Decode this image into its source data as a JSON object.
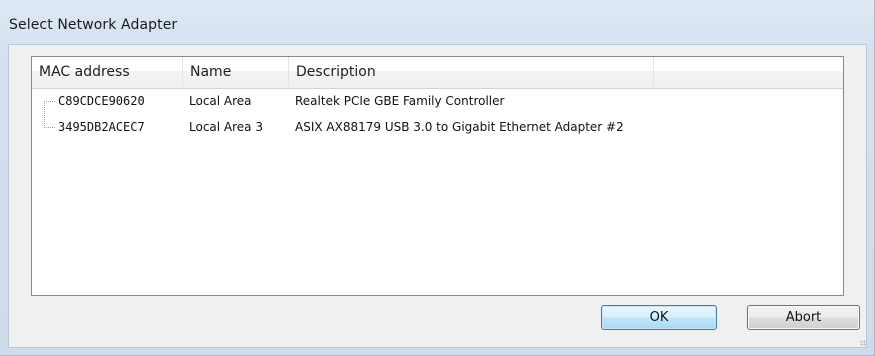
{
  "window": {
    "title": "Select Network Adapter"
  },
  "list": {
    "columns": [
      "MAC address",
      "Name",
      "Description",
      ""
    ],
    "rows": [
      {
        "mac": "C89CDCE90620",
        "name": "Local Area",
        "description": "Realtek PCIe GBE Family Controller"
      },
      {
        "mac": "3495DB2ACEC7",
        "name": "Local Area 3",
        "description": "ASIX AX88179 USB 3.0 to Gigabit Ethernet Adapter #2"
      }
    ]
  },
  "buttons": {
    "ok_label": "OK",
    "abort_label": "Abort"
  },
  "icons": {
    "size_grip": "resize-grip-icon"
  }
}
